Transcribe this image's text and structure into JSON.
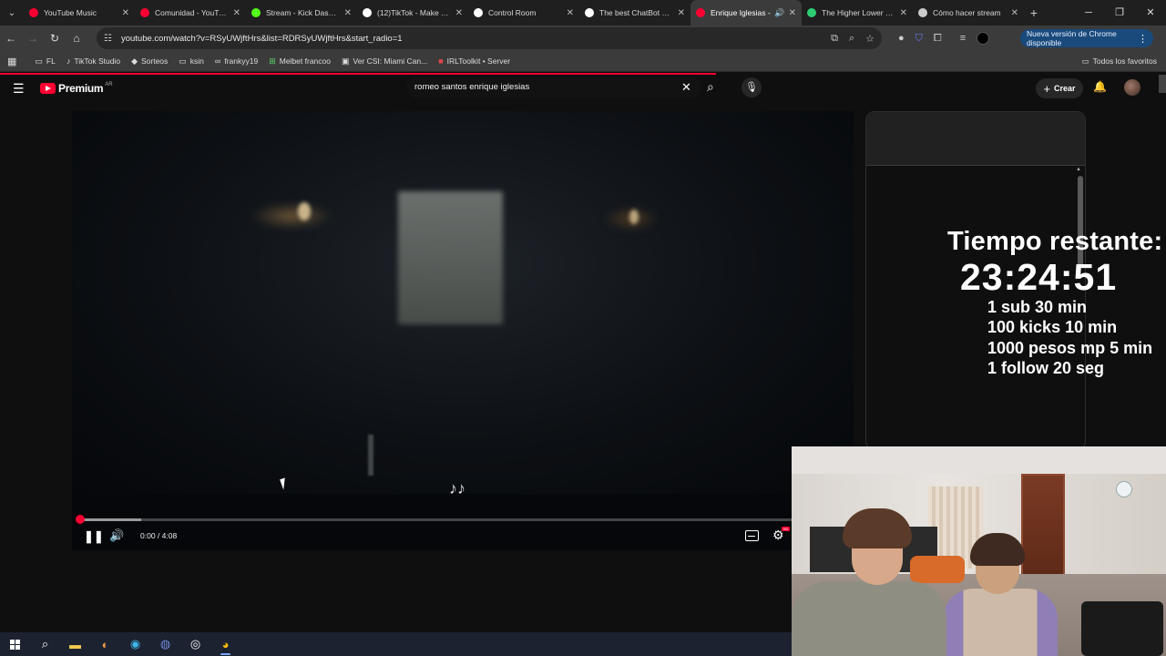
{
  "browser": {
    "tabs": [
      {
        "title": "YouTube Music",
        "color": "#ff0033",
        "active": false
      },
      {
        "title": "Comunidad - YouTube",
        "color": "#ff0033",
        "active": false
      },
      {
        "title": "Stream - Kick Dashboard",
        "color": "#53fc18",
        "active": false
      },
      {
        "title": "(12)TikTok - Make Your Day",
        "color": "#ffffff",
        "active": false
      },
      {
        "title": "Control Room",
        "color": "#ffffff",
        "active": false
      },
      {
        "title": "The best ChatBot and",
        "color": "#ffffff",
        "active": false
      },
      {
        "title": "Enrique Iglesias -",
        "color": "#ff0033",
        "active": true
      },
      {
        "title": "The Higher Lower Game",
        "color": "#2ecc71",
        "active": false
      },
      {
        "title": "Cómo hacer stream",
        "color": "#cccccc",
        "active": false
      }
    ],
    "url": "youtube.com/watch?v=RSyUWjftHrs&list=RDRSyUWjftHrs&start_radio=1",
    "update_label": "Nueva versión de Chrome disponible",
    "bookmarks": [
      {
        "label": "FL",
        "icon": "folder-icon"
      },
      {
        "label": "TikTok Studio",
        "icon": "tiktok-icon"
      },
      {
        "label": "Sorteos",
        "icon": "diamond-icon"
      },
      {
        "label": "ksin",
        "icon": "folder-icon"
      },
      {
        "label": "frankyy19",
        "icon": "link-icon"
      },
      {
        "label": "Melbet francoo",
        "icon": "plus-square-icon"
      },
      {
        "label": "Ver CSI: Miami Can...",
        "icon": "tv-icon"
      },
      {
        "label": "IRLToolkit • Server",
        "icon": "server-icon"
      }
    ],
    "bookmarks_right": "Todos los favoritos"
  },
  "youtube": {
    "brand": "Premium",
    "country": "AR",
    "search_query": "romeo santos enrique iglesias",
    "create_label": "Crear",
    "player": {
      "time_label": "0:00 / 4:08",
      "played_fraction": 0.0,
      "buffered_fraction": 0.08,
      "notes": "♪♪",
      "hd_badge": "HD"
    }
  },
  "overlay": {
    "title": "Tiempo restante:",
    "timer": "23:24:51",
    "rules": [
      "1 sub 30 min",
      "100 kicks 10 min",
      "1000 pesos mp 5 min",
      "1 follow 20 seg"
    ]
  },
  "colors": {
    "accent": "#ff0033",
    "background": "#0f0f0f",
    "update_pill": "#1a4a7c"
  }
}
